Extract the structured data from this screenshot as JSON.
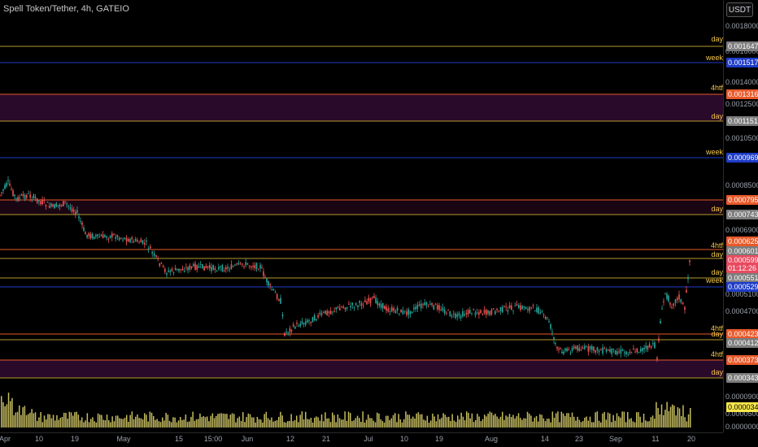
{
  "header": {
    "symbol_title": "Spell Token/Tether, 4h, GATEIO",
    "currency_button": "USDT"
  },
  "colors": {
    "up": "#26a69a",
    "down": "#ef5350",
    "level_yellow": "#b59a2e",
    "level_blue": "#1e3cc8",
    "level_orange": "#e8592a",
    "volume": "#d9cf6a",
    "zone": "#2a0a2a"
  },
  "price_axis": {
    "ticks": [
      "0.0018000",
      "0.0016000",
      "0.0014000",
      "0.0012500",
      "0.0010500",
      "0.0008500",
      "0.0006900",
      "0.0005100",
      "0.0004700",
      "0.0000900",
      "0.0000500",
      "0.0000000"
    ],
    "tags": [
      {
        "label": "0.0016470",
        "style": "gray"
      },
      {
        "label": "0.0015173",
        "style": "blue"
      },
      {
        "label": "0.0013164",
        "style": "orange"
      },
      {
        "label": "0.0011513",
        "style": "gray"
      },
      {
        "label": "0.0009693",
        "style": "blue"
      },
      {
        "label": "0.0007952",
        "style": "orange"
      },
      {
        "label": "0.0007435",
        "style": "gray"
      },
      {
        "label": "0.0006253",
        "style": "orange"
      },
      {
        "label": "0.0006015",
        "style": "gray"
      },
      {
        "label": "0.0005999",
        "style": "red"
      },
      {
        "label": "01:12:26",
        "style": "red"
      },
      {
        "label": "0.0005518",
        "style": "gray"
      },
      {
        "label": "0.0005295",
        "style": "blue"
      },
      {
        "label": "0.0004232",
        "style": "orange"
      },
      {
        "label": "0.0004129",
        "style": "gray"
      },
      {
        "label": "0.0003739",
        "style": "orange"
      },
      {
        "label": "0.0003437",
        "style": "gray"
      },
      {
        "label": "0.0000344",
        "style": "yellow"
      }
    ]
  },
  "level_labels": [
    "day",
    "week",
    "4htf",
    "day",
    "week",
    "day",
    "4htf",
    "day",
    "day",
    "week",
    "4htf",
    "day",
    "4htf",
    "day"
  ],
  "time_axis": [
    "Apr",
    "10",
    "19",
    "May",
    "15",
    "15:00",
    "Jun",
    "12",
    "21",
    "Jul",
    "10",
    "19",
    "Aug",
    "14",
    "23",
    "Sep",
    "11",
    "20"
  ]
}
